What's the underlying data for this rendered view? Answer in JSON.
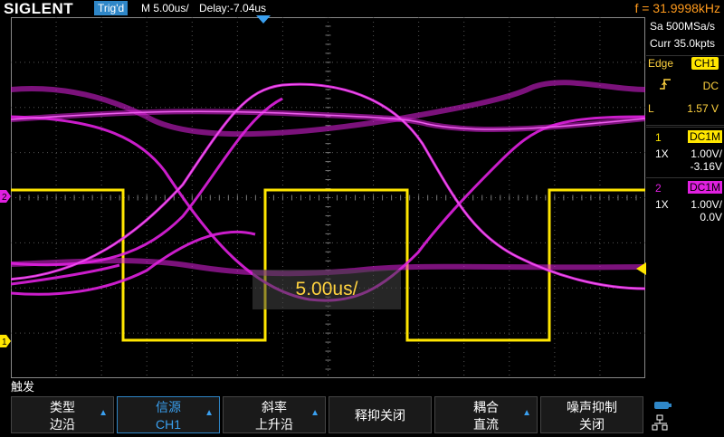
{
  "header": {
    "logo": "SIGLENT",
    "trigger_status": "Trig'd",
    "timebase": "M 5.00us/",
    "delay": "Delay:-7.04us",
    "frequency": "f = 31.9998kHz"
  },
  "acquisition": {
    "sample_rate": "Sa 500MSa/s",
    "memory": "Curr 35.0kpts"
  },
  "trigger": {
    "type": "Edge",
    "source": "CH1",
    "slope_icon": "rising-edge-icon",
    "coupling": "DC",
    "level_label": "L",
    "level": "1.57 V"
  },
  "channels": [
    {
      "number": "1",
      "coupling": "DC1M",
      "probe": "1X",
      "scale": "1.00V/",
      "offset": "-3.16V",
      "color": "#ffe600"
    },
    {
      "number": "2",
      "coupling": "DC1M",
      "probe": "1X",
      "scale": "1.00V/",
      "offset": "0.0V",
      "color": "#e020e0"
    }
  ],
  "overlay": {
    "text": "5.00us/"
  },
  "menu": {
    "title": "触发",
    "buttons": [
      {
        "line1": "类型",
        "line2": "边沿",
        "arrow": true,
        "active": false
      },
      {
        "line1": "信源",
        "line2": "CH1",
        "arrow": true,
        "active": true
      },
      {
        "line1": "斜率",
        "line2": "上升沿",
        "arrow": true,
        "active": false
      },
      {
        "line1": "释抑关闭",
        "line2": "",
        "arrow": false,
        "active": false
      },
      {
        "line1": "耦合",
        "line2": "直流",
        "arrow": true,
        "active": false
      },
      {
        "line1": "噪声抑制",
        "line2": "关闭",
        "arrow": false,
        "active": false
      }
    ]
  },
  "colors": {
    "ch1": "#ffe600",
    "ch2": "#e020e0",
    "trigger_accent": "#ffd23f",
    "frequency": "#ff9a1c",
    "highlight": "#2f87c8"
  }
}
